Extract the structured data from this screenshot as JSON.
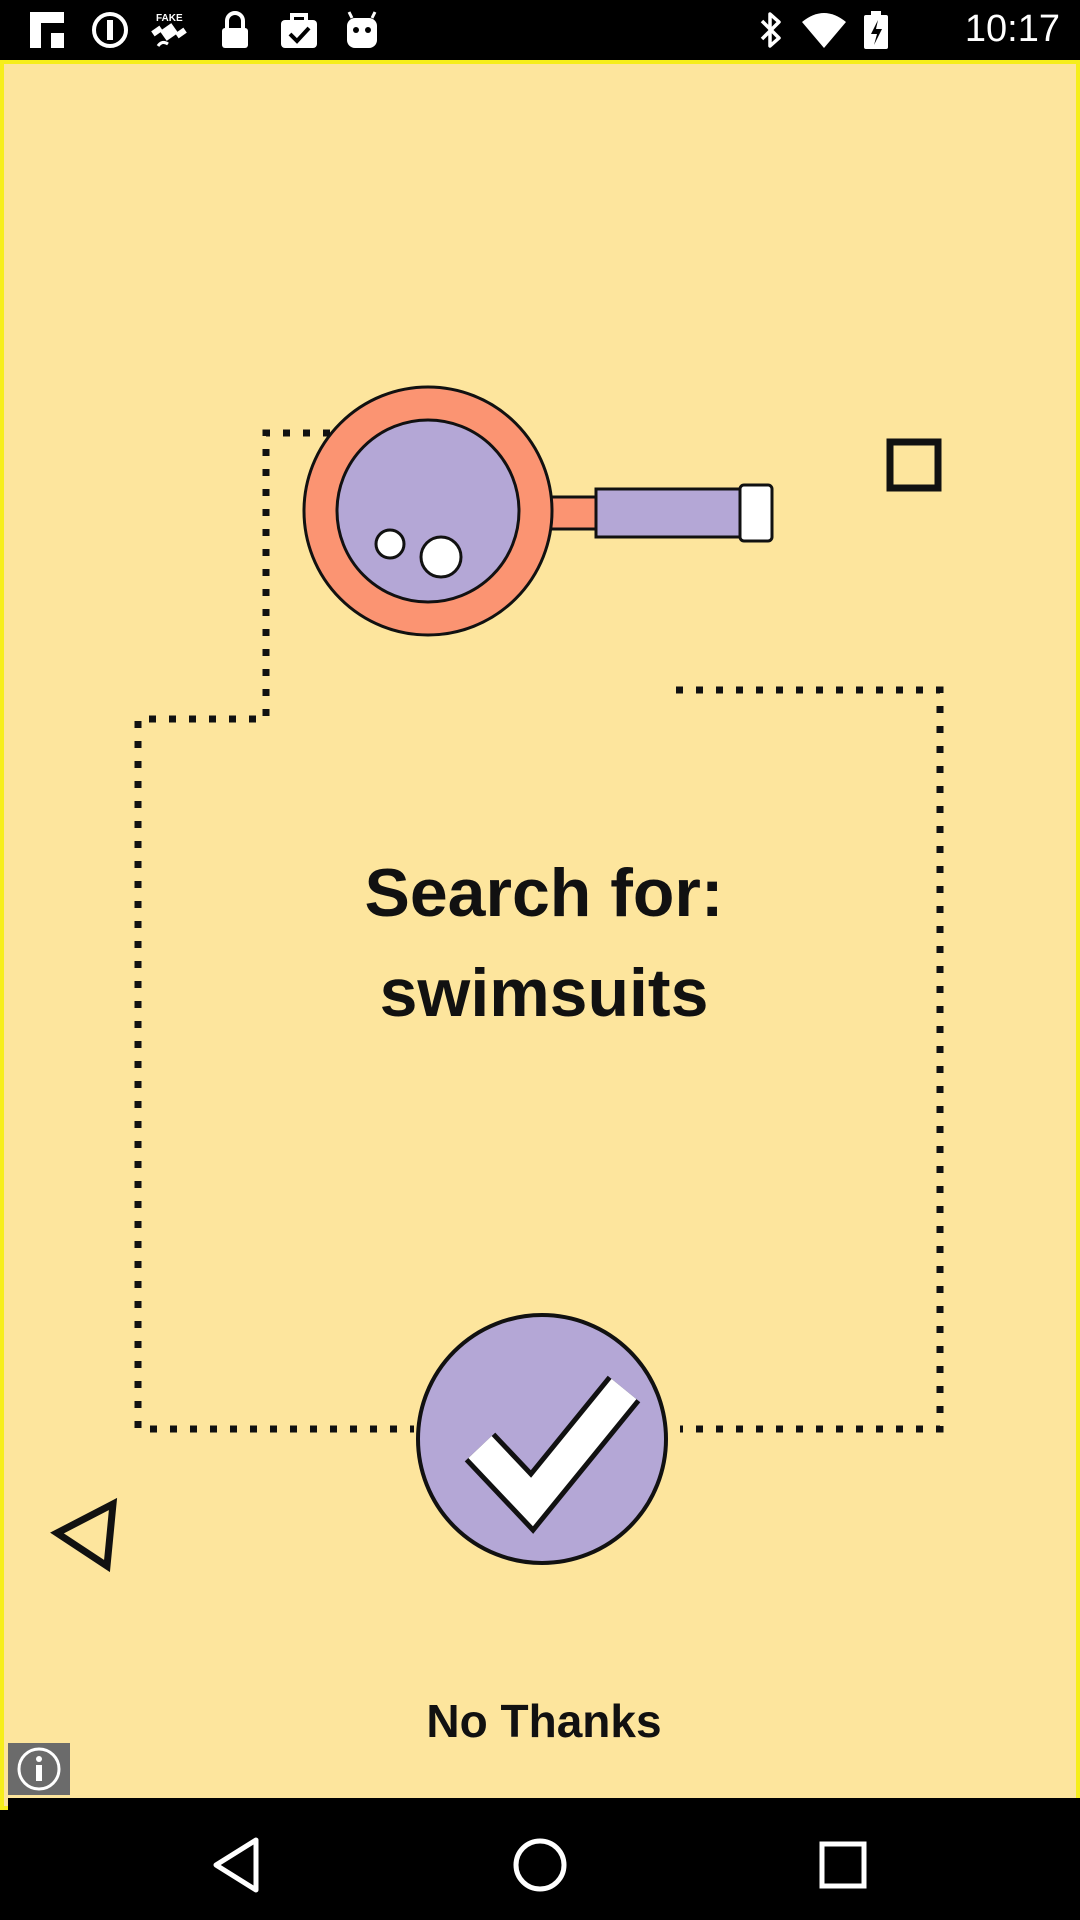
{
  "status_bar": {
    "time": "10:17",
    "left_icons": [
      "flipboard-icon",
      "circle-i-icon",
      "fake-gps-icon",
      "lock-icon",
      "briefcase-check-icon",
      "android-icon"
    ],
    "right_icons": [
      "bluetooth-icon",
      "wifi-icon",
      "battery-charging-icon"
    ]
  },
  "ad": {
    "headline_line1": "Search for:",
    "headline_line2": "swimsuits",
    "no_thanks_label": "No Thanks",
    "icons": [
      "magnifier-icon",
      "checkmark-icon",
      "square-icon",
      "triangle-icon",
      "info-icon"
    ],
    "colors": {
      "background": "#fde59d",
      "border": "#f6ee1c",
      "orange": "#fb9472",
      "lavender": "#b4a7d6"
    }
  },
  "nav_bar": {
    "buttons": [
      "back-icon",
      "home-icon",
      "recents-icon"
    ]
  }
}
